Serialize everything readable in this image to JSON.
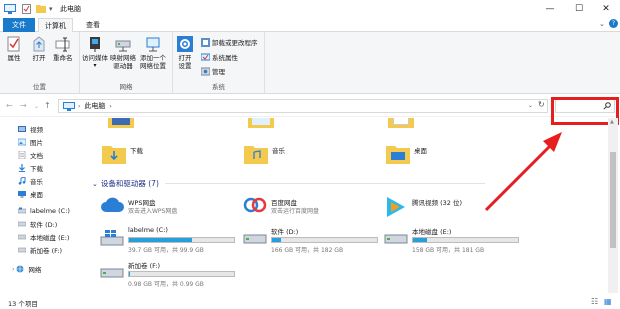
{
  "window": {
    "title": "此电脑",
    "controls": [
      "minimize-icon",
      "maximize-icon",
      "close-icon"
    ]
  },
  "ribbon_tabs": [
    "文件",
    "计算机",
    "查看"
  ],
  "ribbon": {
    "location_group": {
      "label": "位置",
      "buttons": [
        "属性",
        "打开",
        "重命名"
      ]
    },
    "network_group": {
      "label": "网络",
      "buttons": [
        {
          "line1": "访问媒体",
          "line2": ""
        },
        {
          "line1": "映射网络",
          "line2": "驱动器"
        },
        {
          "line1": "添加一个",
          "line2": "网络位置"
        }
      ]
    },
    "system_group": {
      "label": "系统",
      "open_settings": {
        "line1": "打开",
        "line2": "设置"
      },
      "small": [
        "卸载或更改程序",
        "系统属性",
        "管理"
      ]
    }
  },
  "address": {
    "path": "此电脑",
    "search_placeholder": ""
  },
  "nav_items": [
    {
      "label": "视频",
      "icon": "video-icon"
    },
    {
      "label": "图片",
      "icon": "picture-icon"
    },
    {
      "label": "文档",
      "icon": "document-icon"
    },
    {
      "label": "下载",
      "icon": "download-icon"
    },
    {
      "label": "音乐",
      "icon": "music-icon"
    },
    {
      "label": "桌面",
      "icon": "desktop-icon"
    },
    {
      "label": "labelme (C:)",
      "icon": "drive-icon"
    },
    {
      "label": "软件 (D:)",
      "icon": "drive-icon"
    },
    {
      "label": "本地磁盘 (E:)",
      "icon": "drive-icon"
    },
    {
      "label": "新加卷 (F:)",
      "icon": "drive-icon"
    },
    {
      "label": "网络",
      "icon": "network-icon"
    }
  ],
  "folders": [
    "下载",
    "音乐",
    "桌面"
  ],
  "devices_section": "设备和驱动器 (7)",
  "app_drives": [
    {
      "name": "WPS网盘",
      "sub": "双击进入WPS网盘"
    },
    {
      "name": "百度网盘",
      "sub": "双击运行百度网盘"
    },
    {
      "name": "腾讯视频 (32 位)",
      "sub": ""
    }
  ],
  "drives": [
    {
      "name": "labelme (C:)",
      "sub": "39.7 GB 可用，共 99.9 GB",
      "used_fraction": 0.6
    },
    {
      "name": "软件 (D:)",
      "sub": "166 GB 可用，共 182 GB",
      "used_fraction": 0.09
    },
    {
      "name": "本地磁盘 (E:)",
      "sub": "158 GB 可用，共 181 GB",
      "used_fraction": 0.13
    },
    {
      "name": "新加卷 (F:)",
      "sub": "0.98 GB 可用，共 0.99 GB",
      "used_fraction": 0.01
    }
  ],
  "status": {
    "count": "13 个项目"
  },
  "colors": {
    "accent": "#1979ca",
    "highlight": "#e61e1e",
    "bar_fill": "#26a0da"
  }
}
